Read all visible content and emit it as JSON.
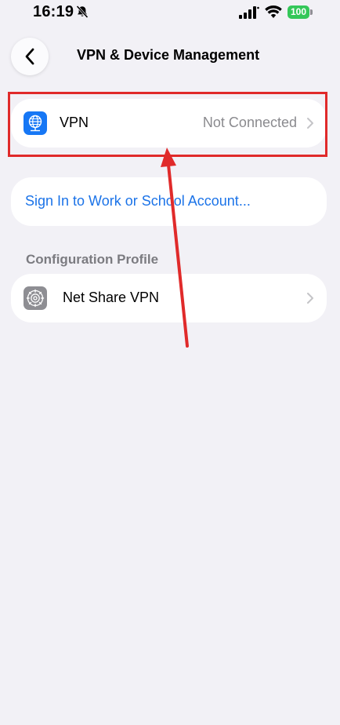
{
  "status_bar": {
    "time": "16:19",
    "battery": "100",
    "battery_color": "#34c759"
  },
  "nav": {
    "title": "VPN & Device Management",
    "back_icon": "chevron-left-icon"
  },
  "vpn_row": {
    "label": "VPN",
    "value": "Not Connected",
    "icon": "vpn-globe-icon",
    "icon_color": "#1677f5"
  },
  "signin_row": {
    "label": "Sign In to Work or School Account..."
  },
  "profile_section": {
    "header": "Configuration Profile",
    "items": [
      {
        "label": "Net Share VPN",
        "icon": "gear-icon",
        "icon_color": "#8e8e93"
      }
    ]
  },
  "annotation": {
    "color": "#e02a2a"
  }
}
